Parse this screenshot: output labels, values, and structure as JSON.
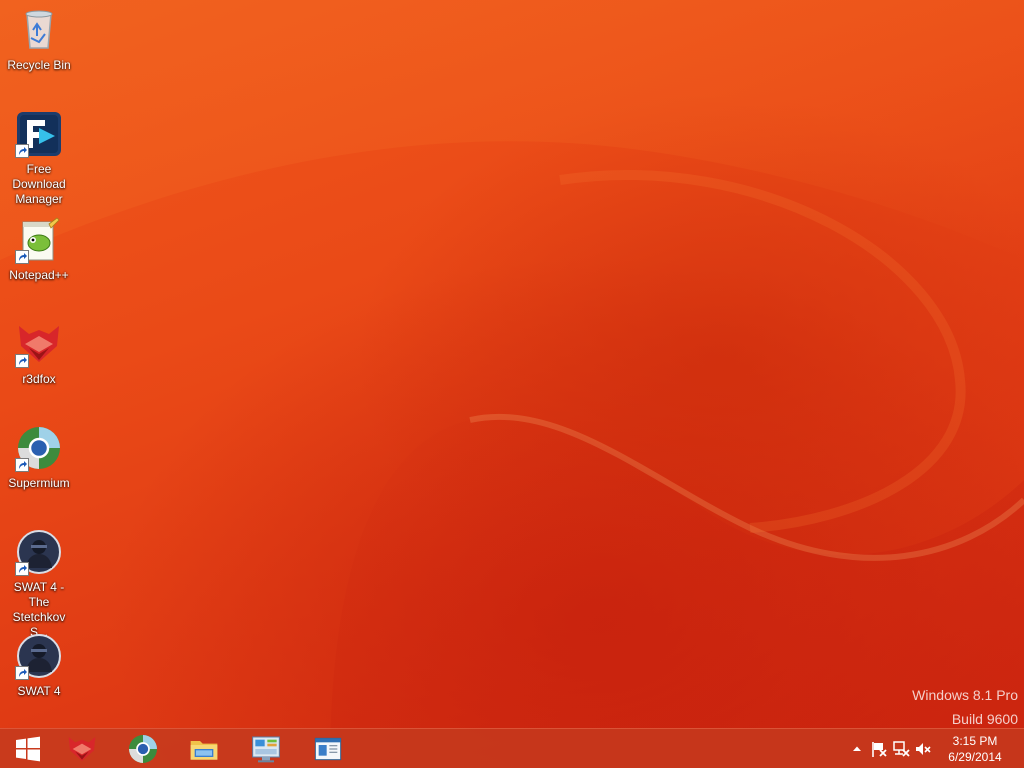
{
  "desktop": {
    "icons": [
      {
        "label": "Recycle Bin",
        "icon": "recycle-bin-icon"
      },
      {
        "label": "Free\nDownload\nManager",
        "icon": "free-download-manager-icon"
      },
      {
        "label": "Notepad++",
        "icon": "notepad-plus-plus-icon"
      },
      {
        "label": "r3dfox",
        "icon": "r3dfox-icon"
      },
      {
        "label": "Supermium",
        "icon": "supermium-icon"
      },
      {
        "label": "SWAT 4 - The\nStetchkov S...",
        "icon": "swat4-stetchkov-icon"
      },
      {
        "label": "SWAT 4",
        "icon": "swat4-icon"
      }
    ]
  },
  "watermark": {
    "line1": "Windows 8.1 Pro",
    "line2": "Build 9600"
  },
  "taskbar": {
    "pinned": [
      "start-icon",
      "r3dfox-icon",
      "supermium-icon",
      "file-explorer-icon",
      "control-panel-icon",
      "window-app-icon"
    ],
    "tray": [
      "show-hidden-icons-icon",
      "action-center-flag-icon",
      "network-icon",
      "volume-muted-icon"
    ],
    "clock": {
      "time": "3:15 PM",
      "date": "6/29/2014"
    }
  },
  "colors": {
    "wallpaper": "#e8401a",
    "taskbar": "#c43a1e"
  }
}
